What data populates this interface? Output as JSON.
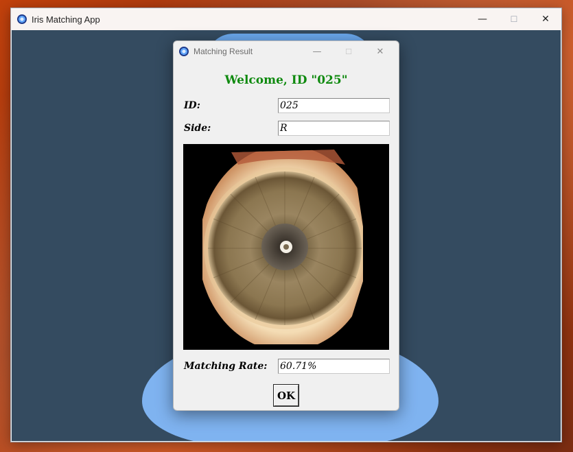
{
  "main_window": {
    "title": "Iris Matching App",
    "controls": {
      "minimize": "—",
      "maximize": "☐",
      "close": "✕"
    }
  },
  "dialog": {
    "title": "Matching Result",
    "controls": {
      "minimize": "—",
      "maximize": "☐",
      "close": "✕"
    },
    "welcome": "Welcome, ID \"025\"",
    "id_label": "ID:",
    "id_value": "025",
    "side_label": "Side:",
    "side_value": "R",
    "rate_label": "Matching Rate:",
    "rate_value": "60.71%",
    "ok_label": "OK"
  },
  "colors": {
    "welcome_text": "#0f8a0f",
    "client_background": "#344b60",
    "dialog_background": "#f0f0f0"
  },
  "icons": {
    "app": "iris-app-icon"
  }
}
